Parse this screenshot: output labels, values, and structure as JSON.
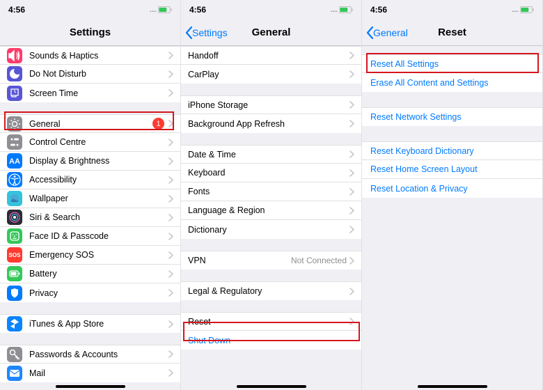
{
  "status": {
    "time": "4:56"
  },
  "p1": {
    "title": "Settings",
    "rows": [
      {
        "id": "sounds",
        "label": "Sounds & Haptics",
        "icon": "#ff3b6a"
      },
      {
        "id": "dnd",
        "label": "Do Not Disturb",
        "icon": "#5856d6"
      },
      {
        "id": "screentime",
        "label": "Screen Time",
        "icon": "#5856d6"
      },
      {
        "id": "general",
        "label": "General",
        "icon": "#8e8e93",
        "badge": "1"
      },
      {
        "id": "controlcentre",
        "label": "Control Centre",
        "icon": "#8e8e93"
      },
      {
        "id": "display",
        "label": "Display & Brightness",
        "icon": "#007aff"
      },
      {
        "id": "accessibility",
        "label": "Accessibility",
        "icon": "#007aff"
      },
      {
        "id": "wallpaper",
        "label": "Wallpaper",
        "icon": "#35c2db"
      },
      {
        "id": "siri",
        "label": "Siri & Search",
        "icon": "#2b2b36"
      },
      {
        "id": "faceid",
        "label": "Face ID & Passcode",
        "icon": "#34c759"
      },
      {
        "id": "sos",
        "label": "Emergency SOS",
        "icon": "#ff3b30"
      },
      {
        "id": "battery",
        "label": "Battery",
        "icon": "#34c759"
      },
      {
        "id": "privacy",
        "label": "Privacy",
        "icon": "#007aff"
      },
      {
        "id": "itunes",
        "label": "iTunes & App Store",
        "icon": "#0a84ff"
      },
      {
        "id": "passwords",
        "label": "Passwords & Accounts",
        "icon": "#8e8e93"
      },
      {
        "id": "mail",
        "label": "Mail",
        "icon": "#1f87ff"
      }
    ]
  },
  "p2": {
    "back": "Settings",
    "title": "General",
    "groups": [
      [
        {
          "id": "handoff",
          "label": "Handoff"
        },
        {
          "id": "carplay",
          "label": "CarPlay"
        }
      ],
      [
        {
          "id": "storage",
          "label": "iPhone Storage"
        },
        {
          "id": "refresh",
          "label": "Background App Refresh"
        }
      ],
      [
        {
          "id": "datetime",
          "label": "Date & Time"
        },
        {
          "id": "keyboard",
          "label": "Keyboard"
        },
        {
          "id": "fonts",
          "label": "Fonts"
        },
        {
          "id": "lang",
          "label": "Language & Region"
        },
        {
          "id": "dict",
          "label": "Dictionary"
        }
      ],
      [
        {
          "id": "vpn",
          "label": "VPN",
          "value": "Not Connected"
        }
      ],
      [
        {
          "id": "legal",
          "label": "Legal & Regulatory"
        }
      ],
      [
        {
          "id": "reset",
          "label": "Reset"
        },
        {
          "id": "shutdown",
          "label": "Shut Down",
          "link": true,
          "nochev": true
        }
      ]
    ]
  },
  "p3": {
    "back": "General",
    "title": "Reset",
    "groups": [
      [
        {
          "id": "resetall",
          "label": "Reset All Settings"
        },
        {
          "id": "eraseall",
          "label": "Erase All Content and Settings"
        }
      ],
      [
        {
          "id": "resetnet",
          "label": "Reset Network Settings"
        }
      ],
      [
        {
          "id": "resetkey",
          "label": "Reset Keyboard Dictionary"
        },
        {
          "id": "resethome",
          "label": "Reset Home Screen Layout"
        },
        {
          "id": "resetloc",
          "label": "Reset Location & Privacy"
        }
      ]
    ]
  }
}
